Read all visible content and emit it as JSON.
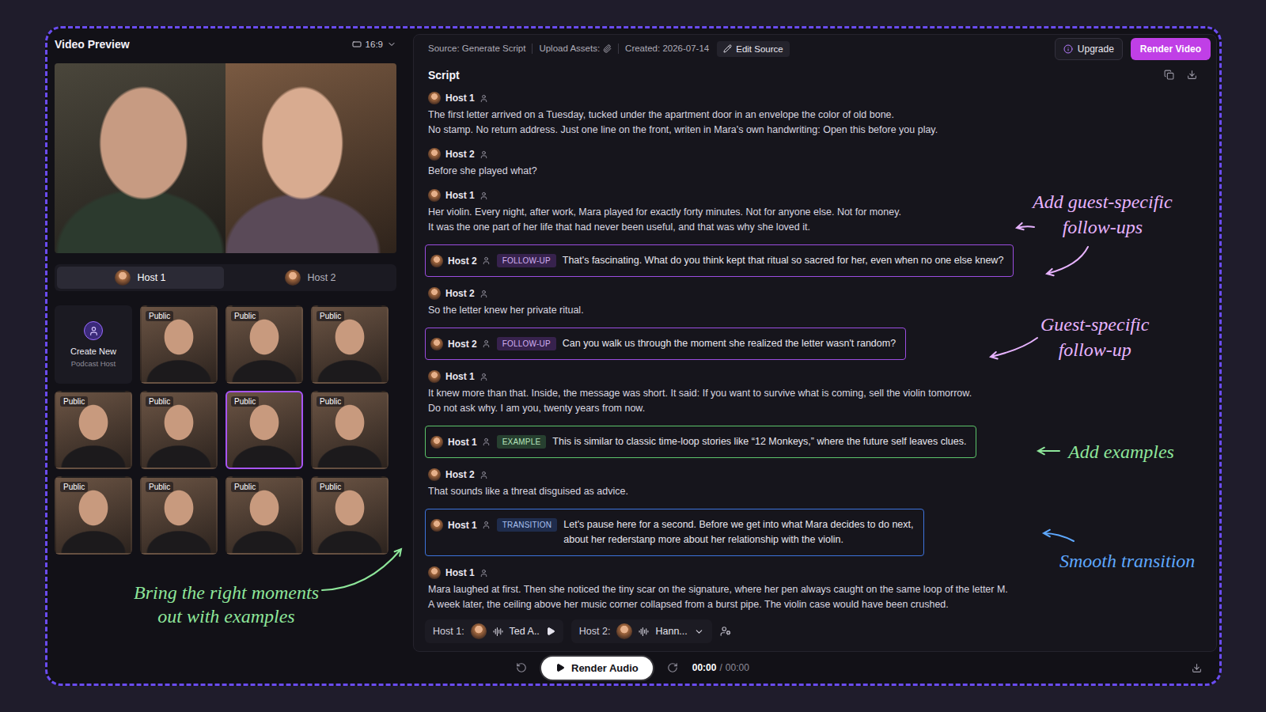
{
  "left_panel": {
    "title": "Video Preview",
    "aspect_ratio": "16:9",
    "host_tabs": [
      {
        "label": "Host 1",
        "selected": true
      },
      {
        "label": "Host 2",
        "selected": false
      }
    ],
    "create_card": {
      "title": "Create New",
      "subtitle": "Podcast Host"
    },
    "host_cards": [
      {
        "badge": "Public",
        "selected": false
      },
      {
        "badge": "Public",
        "selected": false
      },
      {
        "badge": "Public",
        "selected": false
      },
      {
        "badge": "Public",
        "selected": false
      },
      {
        "badge": "Public",
        "selected": false
      },
      {
        "badge": "Public",
        "selected": true
      },
      {
        "badge": "Public",
        "selected": false
      },
      {
        "badge": "Public",
        "selected": false
      },
      {
        "badge": "Public",
        "selected": false
      },
      {
        "badge": "Public",
        "selected": false
      },
      {
        "badge": "Public",
        "selected": false
      }
    ],
    "annotation": {
      "lines": [
        "Bring the right moments",
        "out with examples"
      ],
      "color": "#8ee69a"
    }
  },
  "toolbar": {
    "meta": [
      {
        "label": "Source: Generate Script"
      },
      {
        "label": "Upload Assets:"
      },
      {
        "label": "Created: 2026-07-14"
      }
    ],
    "edit_button": "Edit Source",
    "upgrade_button": "Upgrade",
    "render_video_button": "Render Video"
  },
  "script": {
    "title": "Script",
    "entries": [
      {
        "speaker": "Host 1",
        "kind": "line",
        "lines": [
          "The first letter arrived on a Tuesday, tucked under the apartment door in an envelope the color of old bone.",
          "No stamp. No return address. Just one line on the front, writen in Mara's own handwriting: Open this before you play."
        ]
      },
      {
        "speaker": "Host 2",
        "kind": "line",
        "lines": [
          "Before she played what?"
        ]
      },
      {
        "speaker": "Host 1",
        "kind": "line",
        "lines": [
          "Her violin. Every night, after work, Mara played for exactly forty minutes. Not for anyone else. Not for money.",
          "It was the one part of her life that had never been useful, and that was why she loved it."
        ]
      },
      {
        "speaker": "Host 2",
        "kind": "highlight",
        "tag": "FOLLOW-UP",
        "color": "#9b4de0",
        "lines": [
          "That's fascinating. What do you think kept that ritual so sacred for her, even when no one else knew?"
        ]
      },
      {
        "speaker": "Host 2",
        "kind": "line",
        "lines": [
          "So the letter knew her private ritual."
        ]
      },
      {
        "speaker": "Host 2",
        "kind": "highlight",
        "tag": "FOLLOW-UP",
        "color": "#9b4de0",
        "lines": [
          "Can you walk us through the moment she realized the letter wasn't random?"
        ]
      },
      {
        "speaker": "Host 1",
        "kind": "line",
        "lines": [
          "It knew more than that. Inside, the message was short. It said: If you want to survive what is coming, sell the violin tomorrow.",
          "Do not ask why. I am you, twenty years from now."
        ]
      },
      {
        "speaker": "Host 1",
        "kind": "highlight",
        "tag": "EXAMPLE",
        "color": "#5cc46a",
        "lines": [
          "This is similar to classic time-loop stories like “12 Monkeys,” where the future self leaves clues."
        ]
      },
      {
        "speaker": "Host 2",
        "kind": "line",
        "lines": [
          "That sounds like a threat disguised as advice."
        ]
      },
      {
        "speaker": "Host 1",
        "kind": "highlight",
        "tag": "TRANSITION",
        "color": "#3d73dc",
        "lines": [
          "Let's pause here for a second. Before we get into what Mara decides to do next,",
          "about her rederstanp more about her relationship with the violin."
        ]
      },
      {
        "speaker": "Host 1",
        "kind": "line",
        "lines": [
          "Mara laughed at first. Then she noticed the tiny scar on the signature, where her pen always caught on the same loop of the letter M.",
          "A week later, the ceiling above her music corner collapsed from a burst pipe. The violin case would have been crushed."
        ]
      }
    ]
  },
  "annotations": [
    {
      "lines": [
        "Add guest-specific",
        "follow-ups"
      ],
      "color": "#e7b3ff"
    },
    {
      "lines": [
        "Guest-specific",
        "follow-up"
      ],
      "color": "#e7b3ff"
    },
    {
      "lines": [
        "Add examples"
      ],
      "color": "#8ee69a"
    },
    {
      "lines": [
        "Smooth transition"
      ],
      "color": "#5ea8ff"
    }
  ],
  "voices": [
    {
      "label": "Host 1:",
      "voice": "Ted A..",
      "kind": "play"
    },
    {
      "label": "Host 2:",
      "voice": "Hann...",
      "kind": "dropdown"
    }
  ],
  "player": {
    "render_button": "Render Audio",
    "current": "00:00",
    "separator": "/",
    "total": "00:00"
  }
}
